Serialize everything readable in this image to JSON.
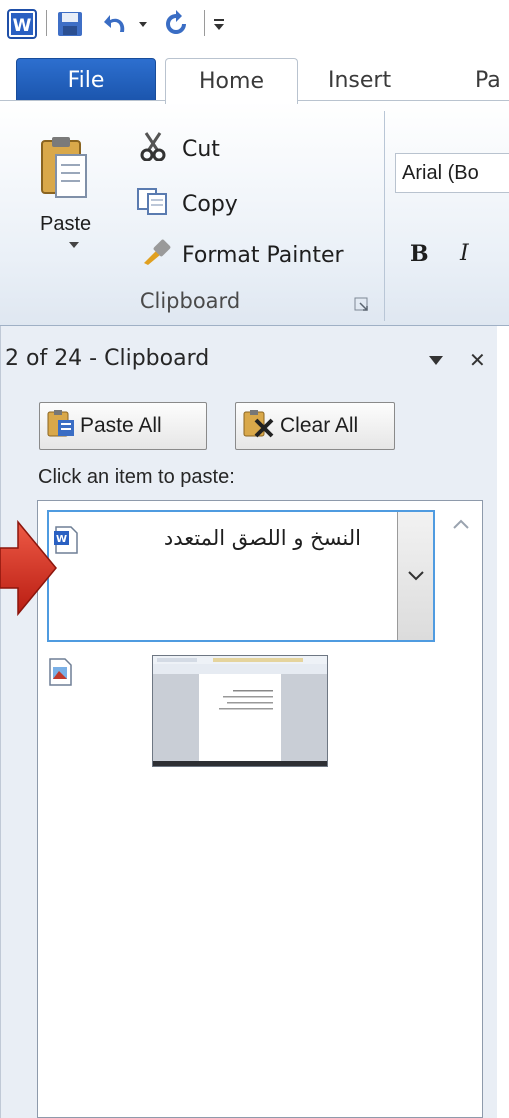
{
  "quick_access": {
    "icons": [
      "word-app-icon",
      "save-icon",
      "undo-icon",
      "undo-dropdown-icon",
      "redo-icon",
      "customize-qat-icon"
    ]
  },
  "tabs": [
    "File",
    "Home",
    "Insert",
    "Pa"
  ],
  "ribbon": {
    "paste_label": "Paste",
    "cut_label": "Cut",
    "copy_label": "Copy",
    "format_painter_label": "Format Painter",
    "group_label": "Clipboard",
    "font_name": "Arial (Bo",
    "bold_label": "B",
    "italic_label": "I"
  },
  "pane": {
    "title": "2 of 24 - Clipboard",
    "paste_all_label": "Paste All",
    "clear_all_label": "Clear All",
    "hint": "Click an item to paste:",
    "items": [
      {
        "text": "النسخ و اللصق المتعدد",
        "type": "word-text"
      },
      {
        "text": "",
        "type": "image"
      }
    ]
  },
  "colors": {
    "file_tab": "#1b55ad",
    "selection_border": "#4f9be0",
    "arrow": "#d02a1e",
    "pane_bg": "#e9eef5"
  }
}
